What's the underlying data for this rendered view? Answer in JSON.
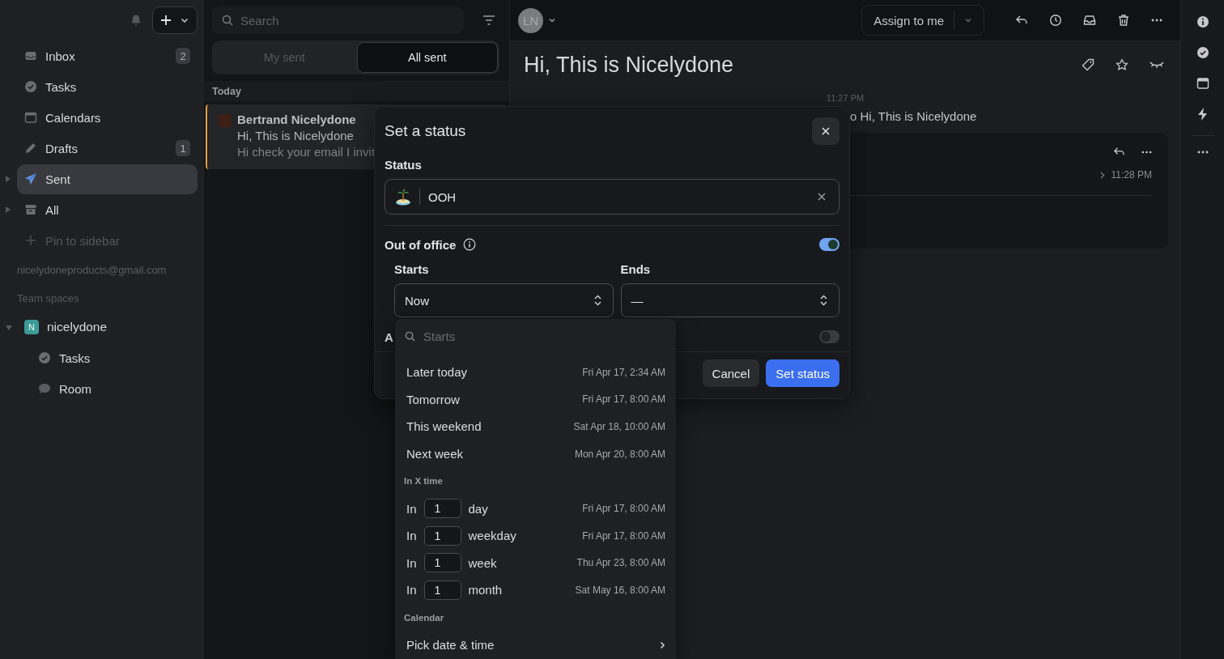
{
  "sidebar": {
    "items": [
      {
        "kind": "inbox",
        "label": "Inbox",
        "badge": "2",
        "selected": false
      },
      {
        "kind": "tasks",
        "label": "Tasks",
        "selected": false
      },
      {
        "kind": "calendar",
        "label": "Calendars",
        "selected": false
      },
      {
        "kind": "drafts",
        "label": "Drafts",
        "badge": "1",
        "selected": false
      },
      {
        "kind": "sent",
        "label": "Sent",
        "selected": true,
        "expandable": true
      },
      {
        "kind": "archive",
        "label": "All",
        "selected": false,
        "expandable": true
      },
      {
        "kind": "add",
        "label": "Pin to sidebar",
        "selected": false
      }
    ],
    "account": "nicelydoneproducts@gmail.com",
    "team_heading": "Team spaces",
    "team": {
      "initial": "N",
      "name": "nicelydone",
      "expanded": true,
      "children": [
        {
          "kind": "tasks",
          "label": "Tasks"
        },
        {
          "kind": "chat",
          "label": "Room"
        }
      ]
    }
  },
  "list": {
    "search": {
      "placeholder": "Search"
    },
    "tabs": [
      {
        "label": "My sent",
        "selected": false
      },
      {
        "label": "All sent",
        "selected": true
      }
    ],
    "group": "Today",
    "messages": [
      {
        "sender": "Bertrand Nicelydone",
        "subject": "Hi, This is Nicelydone",
        "preview": "Hi check your email I invit",
        "selected": true
      }
    ]
  },
  "main": {
    "avatar": "LN",
    "assign": "Assign to me",
    "title": "Hi, This is Nicelydone",
    "time": "11:27 PM",
    "activity": "o Hi, This is Nicelydone",
    "card_time": "11:28 PM"
  },
  "modal": {
    "title": "Set a status",
    "status_label": "Status",
    "status_value": "OOH",
    "out_of_office": {
      "label": "Out of office",
      "on": true
    },
    "starts": {
      "label": "Starts",
      "value": "Now"
    },
    "ends": {
      "label": "Ends",
      "value": "—"
    },
    "auto": {
      "label": "A",
      "on": false
    },
    "buttons": [
      {
        "kind": "secondary",
        "label": "Cancel"
      },
      {
        "kind": "primary",
        "label": "Set status"
      }
    ]
  },
  "dropdown": {
    "placeholder": "Starts",
    "presets": [
      {
        "label": "Later today",
        "date": "Fri Apr 17, 2:34 AM"
      },
      {
        "label": "Tomorrow",
        "date": "Fri Apr 17, 8:00 AM"
      },
      {
        "label": "This weekend",
        "date": "Sat Apr 18, 10:00 AM"
      },
      {
        "label": "Next week",
        "date": "Mon Apr 20, 8:00 AM"
      }
    ],
    "relative_heading": "In X time",
    "relative": [
      {
        "prefix": "In",
        "amount": "1",
        "unit": "day",
        "date": "Fri Apr 17, 8:00 AM"
      },
      {
        "prefix": "In",
        "amount": "1",
        "unit": "weekday",
        "date": "Fri Apr 17, 8:00 AM"
      },
      {
        "prefix": "In",
        "amount": "1",
        "unit": "week",
        "date": "Thu Apr 23, 8:00 AM"
      },
      {
        "prefix": "In",
        "amount": "1",
        "unit": "month",
        "date": "Sat May 16, 8:00 AM"
      }
    ],
    "calendar_heading": "Calendar",
    "pick": "Pick date & time"
  }
}
